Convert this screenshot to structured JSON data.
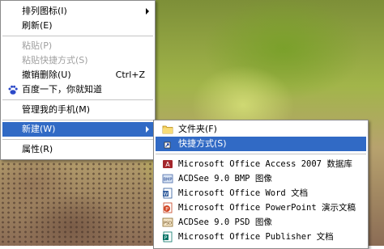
{
  "context_menu": {
    "items": [
      {
        "label": "排列图标(I)",
        "has_submenu": true
      },
      {
        "label": "刷新(E)"
      },
      {
        "label": "粘贴(P)",
        "disabled": true
      },
      {
        "label": "粘贴快捷方式(S)",
        "disabled": true
      },
      {
        "label": "撤销删除(U)",
        "shortcut": "Ctrl+Z"
      },
      {
        "label": "百度一下，你就知道",
        "icon": "baidu-paw-icon"
      },
      {
        "label": "管理我的手机(M)"
      },
      {
        "label": "新建(W)",
        "has_submenu": true,
        "selected": true
      },
      {
        "label": "属性(R)"
      }
    ]
  },
  "new_submenu": {
    "items": [
      {
        "label": "文件夹(F)",
        "icon": "folder-icon"
      },
      {
        "label": "快捷方式(S)",
        "icon": "shortcut-icon",
        "selected": true
      },
      {
        "label": "Microsoft Office Access 2007 数据库",
        "icon": "access-icon"
      },
      {
        "label": "ACDSee 9.0 BMP 图像",
        "icon": "bmp-image-icon"
      },
      {
        "label": "Microsoft Office Word 文档",
        "icon": "word-icon"
      },
      {
        "label": "Microsoft Office PowerPoint 演示文稿",
        "icon": "powerpoint-icon"
      },
      {
        "label": "ACDSee 9.0 PSD 图像",
        "icon": "psd-image-icon"
      },
      {
        "label": "Microsoft Office Publisher 文档",
        "icon": "publisher-icon"
      }
    ]
  },
  "colors": {
    "selection": "#316ac5",
    "menu_bg": "#ffffff",
    "disabled_text": "#a0a0a0"
  }
}
